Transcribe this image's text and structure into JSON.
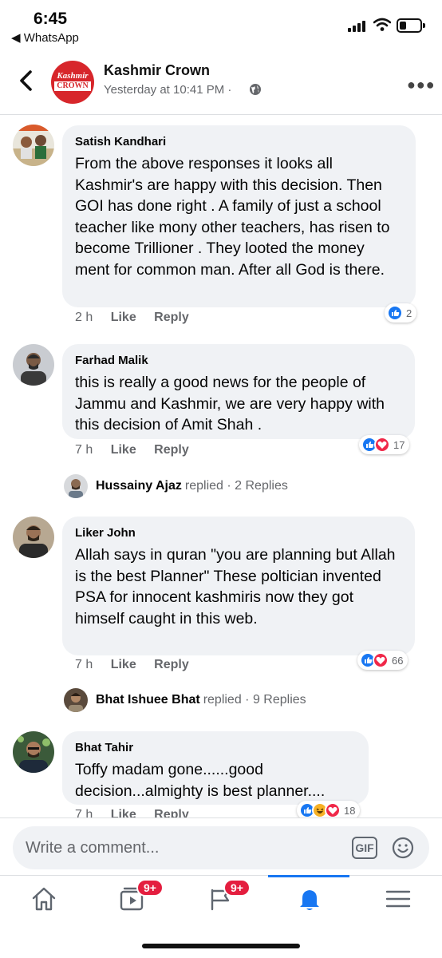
{
  "status_bar": {
    "time": "6:45",
    "back_app": "◀ WhatsApp"
  },
  "header": {
    "page_name": "Kashmir Crown",
    "post_time": "Yesterday at 10:41 PM · ",
    "avatar_line1": "Kashmir",
    "avatar_line2": "CROWN",
    "back_icon": "chevron-left-icon",
    "more_icon": "more-horizontal-icon"
  },
  "comments": [
    {
      "author": "Satish Kandhari",
      "text": "From the above responses it looks all Kashmir's are happy with this decision. Then GOI has done right . A family of just a school teacher like mony other teachers, has risen to become Trillioner . They looted the money ment for common man. After all God is there.",
      "time": "2 h",
      "like": "Like",
      "reply": "Reply",
      "reaction_count": "2",
      "reactions": [
        "like"
      ]
    },
    {
      "author": "Farhad Malik",
      "text": "this is really a good news for the people of Jammu and Kashmir, we are very happy with this decision of Amit Shah .",
      "time": "7 h",
      "like": "Like",
      "reply": "Reply",
      "reaction_count": "17",
      "reactions": [
        "like",
        "love"
      ],
      "replied_by": "Hussainy Ajaz",
      "replied_rest": "replied · 2 Replies"
    },
    {
      "author": "Liker John",
      "text": "Allah says in quran \"you are planning but Allah is the best Planner\" These  poltician invented PSA for innocent kashmiris now they got himself caught in this web.",
      "time": "7 h",
      "like": "Like",
      "reply": "Reply",
      "reaction_count": "66",
      "reactions": [
        "like",
        "love"
      ],
      "replied_by": "Bhat Ishuee Bhat",
      "replied_rest": "replied · 9 Replies"
    },
    {
      "author": "Bhat Tahir",
      "text": "Toffy madam gone......good decision...almighty is best planner....",
      "time": "7 h",
      "like": "Like",
      "reply": "Reply",
      "reaction_count": "18",
      "reactions": [
        "like",
        "haha",
        "love"
      ]
    }
  ],
  "composer": {
    "placeholder": "Write a comment...",
    "gif_label": "GIF"
  },
  "bottom_nav": {
    "items": [
      "home-icon",
      "watch-icon",
      "pages-icon",
      "notifications-icon",
      "menu-icon"
    ],
    "watch_badge": "9+",
    "pages_badge": "9+",
    "active_item": "notifications-icon"
  },
  "colors": {
    "accent": "#1877f2",
    "bubble": "#f0f2f5",
    "secondary_text": "#65676b",
    "badge": "#e41e3f",
    "love": "#f02849",
    "haha": "#f7b125",
    "brand_red": "#d7262b"
  }
}
